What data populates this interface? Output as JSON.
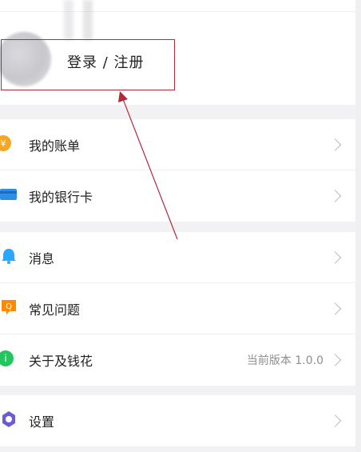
{
  "profile": {
    "login_label": "登录 / 注册"
  },
  "sections": [
    {
      "items": [
        {
          "label": "我的账单",
          "icon": "yuan-coin-icon",
          "color": "#f5a623"
        },
        {
          "label": "我的银行卡",
          "icon": "bank-card-icon",
          "color": "#2f8de4"
        }
      ]
    },
    {
      "items": [
        {
          "label": "消息",
          "icon": "bell-icon",
          "color": "#2aa7ff"
        },
        {
          "label": "常见问题",
          "icon": "faq-icon",
          "color": "#ff8a00"
        },
        {
          "label": "关于及钱花",
          "icon": "info-icon",
          "color": "#22c55e",
          "extra": "当前版本 1.0.0"
        }
      ]
    },
    {
      "items": [
        {
          "label": "设置",
          "icon": "settings-gear-icon",
          "color": "#6b5bd6"
        }
      ]
    }
  ],
  "annotation": {
    "color": "#b02a3a"
  }
}
